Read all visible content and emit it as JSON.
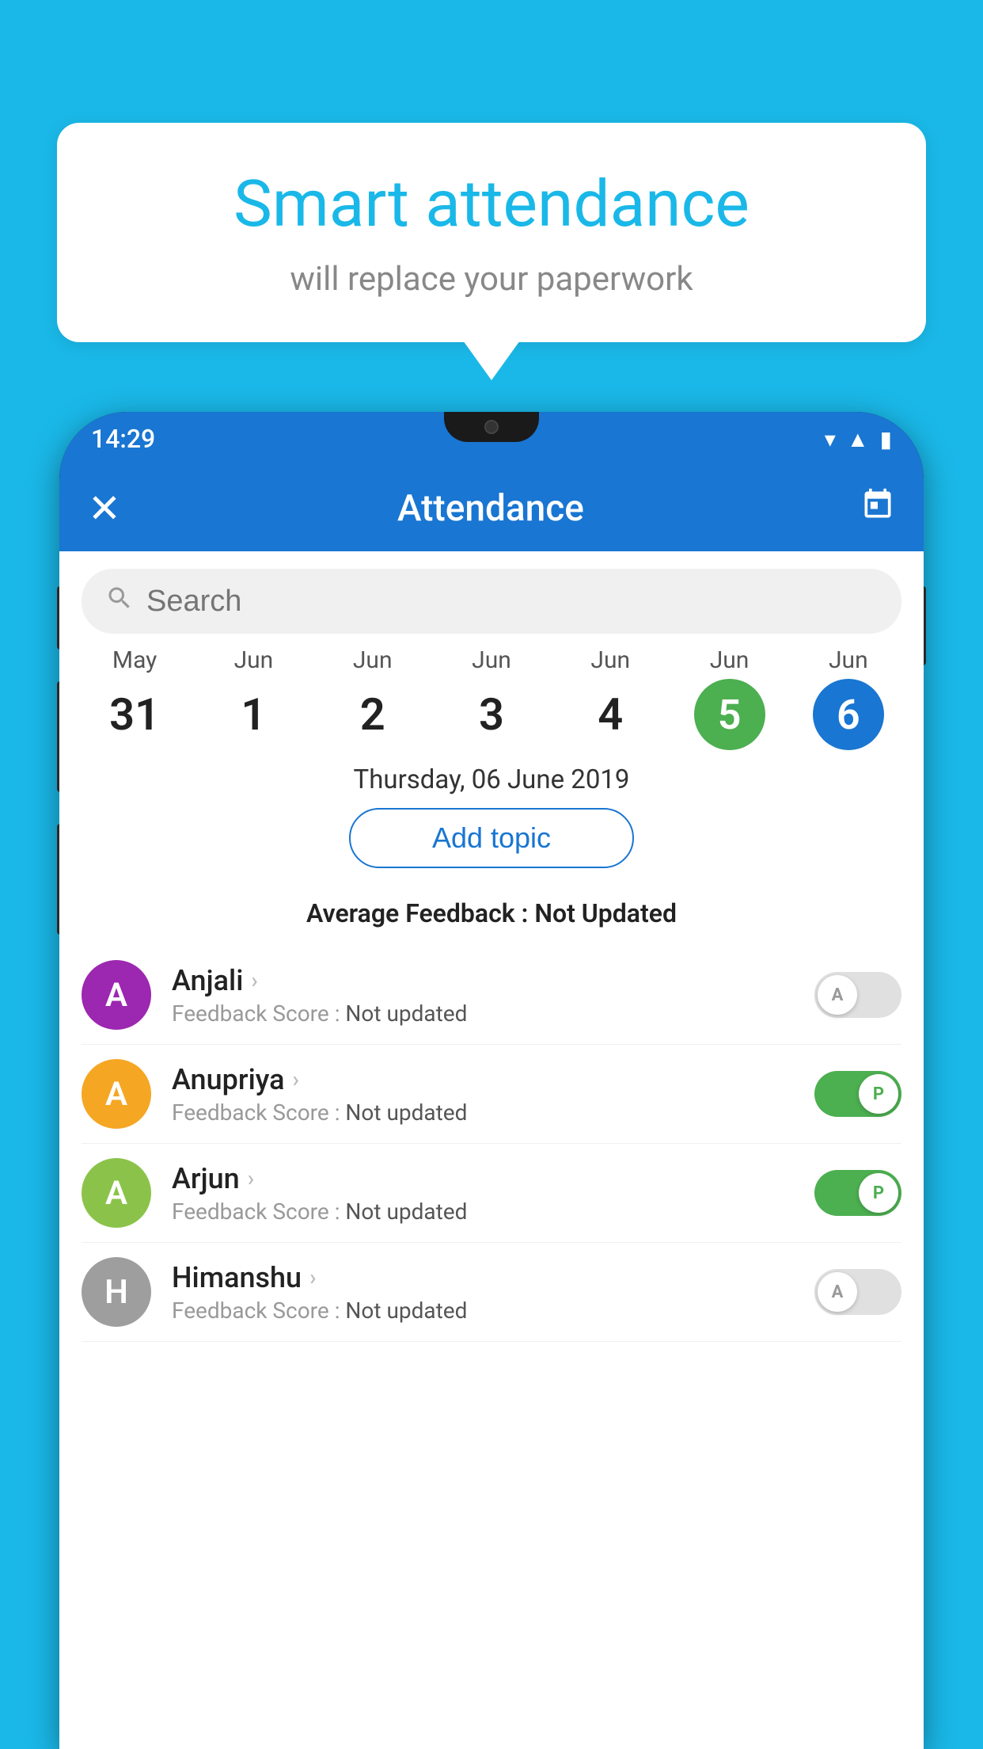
{
  "background_color": "#1ab8e8",
  "bubble": {
    "title": "Smart attendance",
    "subtitle": "will replace your paperwork"
  },
  "phone": {
    "status_bar": {
      "time": "14:29",
      "wifi_icon": "▾",
      "signal_icon": "▲",
      "battery_icon": "▮"
    },
    "toolbar": {
      "close_label": "✕",
      "title": "Attendance",
      "calendar_icon": "📅"
    },
    "search": {
      "placeholder": "Search"
    },
    "dates": [
      {
        "month": "May",
        "day": "31",
        "selected": false
      },
      {
        "month": "Jun",
        "day": "1",
        "selected": false
      },
      {
        "month": "Jun",
        "day": "2",
        "selected": false
      },
      {
        "month": "Jun",
        "day": "3",
        "selected": false
      },
      {
        "month": "Jun",
        "day": "4",
        "selected": false
      },
      {
        "month": "Jun",
        "day": "5",
        "selected": "green"
      },
      {
        "month": "Jun",
        "day": "6",
        "selected": "blue"
      }
    ],
    "selected_date_text": "Thursday, 06 June 2019",
    "add_topic_label": "Add topic",
    "avg_feedback_label": "Average Feedback : ",
    "avg_feedback_value": "Not Updated",
    "students": [
      {
        "name": "Anjali",
        "initial": "A",
        "avatar_color": "#9c27b0",
        "feedback_label": "Feedback Score : ",
        "feedback_value": "Not updated",
        "toggle": "off",
        "toggle_label": "A"
      },
      {
        "name": "Anupriya",
        "initial": "A",
        "avatar_color": "#f5a623",
        "feedback_label": "Feedback Score : ",
        "feedback_value": "Not updated",
        "toggle": "on",
        "toggle_label": "P"
      },
      {
        "name": "Arjun",
        "initial": "A",
        "avatar_color": "#8bc34a",
        "feedback_label": "Feedback Score : ",
        "feedback_value": "Not updated",
        "toggle": "on",
        "toggle_label": "P"
      },
      {
        "name": "Himanshu",
        "initial": "H",
        "avatar_color": "#9e9e9e",
        "feedback_label": "Feedback Score : ",
        "feedback_value": "Not updated",
        "toggle": "off",
        "toggle_label": "A"
      }
    ]
  }
}
